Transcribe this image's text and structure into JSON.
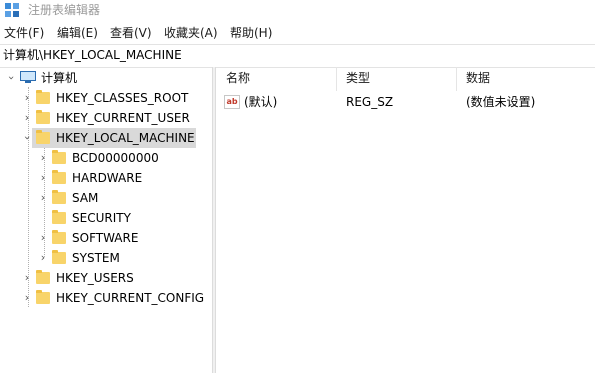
{
  "window": {
    "title": "注册表编辑器",
    "icon": "regedit-icon"
  },
  "menu": [
    "文件(F)",
    "编辑(E)",
    "查看(V)",
    "收藏夹(A)",
    "帮助(H)"
  ],
  "address": "计算机\\HKEY_LOCAL_MACHINE",
  "tree": {
    "root": "计算机",
    "hives": [
      {
        "label": "HKEY_CLASSES_ROOT"
      },
      {
        "label": "HKEY_CURRENT_USER"
      },
      {
        "label": "HKEY_LOCAL_MACHINE",
        "selected": true,
        "expanded": true
      },
      {
        "label": "HKEY_USERS"
      },
      {
        "label": "HKEY_CURRENT_CONFIG"
      }
    ],
    "hklm_children": [
      "BCD00000000",
      "HARDWARE",
      "SAM",
      "SECURITY",
      "SOFTWARE",
      "SYSTEM"
    ]
  },
  "list": {
    "columns": [
      "名称",
      "类型",
      "数据"
    ],
    "rows": [
      {
        "name": "(默认)",
        "type": "REG_SZ",
        "data": "(数值未设置)",
        "icon": "string-value-icon"
      }
    ]
  },
  "colors": {
    "folder": "#f8d46a",
    "selected_bg": "#d9d9d9",
    "title_text": "#9a9a9a"
  }
}
